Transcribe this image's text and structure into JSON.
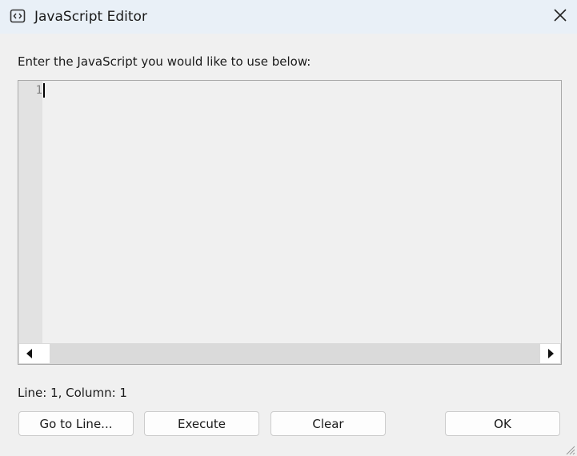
{
  "window": {
    "title": "JavaScript Editor",
    "icon": "code-window-icon",
    "close_icon": "close-icon"
  },
  "prompt": "Enter the JavaScript you would like to use below:",
  "editor": {
    "line_numbers": [
      "1"
    ],
    "content": ""
  },
  "status": "Line: 1, Column: 1",
  "buttons": {
    "goto": "Go to Line...",
    "execute": "Execute",
    "clear": "Clear",
    "ok": "OK"
  },
  "colors": {
    "titlebar": "#e9f0f7",
    "background": "#f0f0f0",
    "gutter": "#e2e2e2"
  }
}
